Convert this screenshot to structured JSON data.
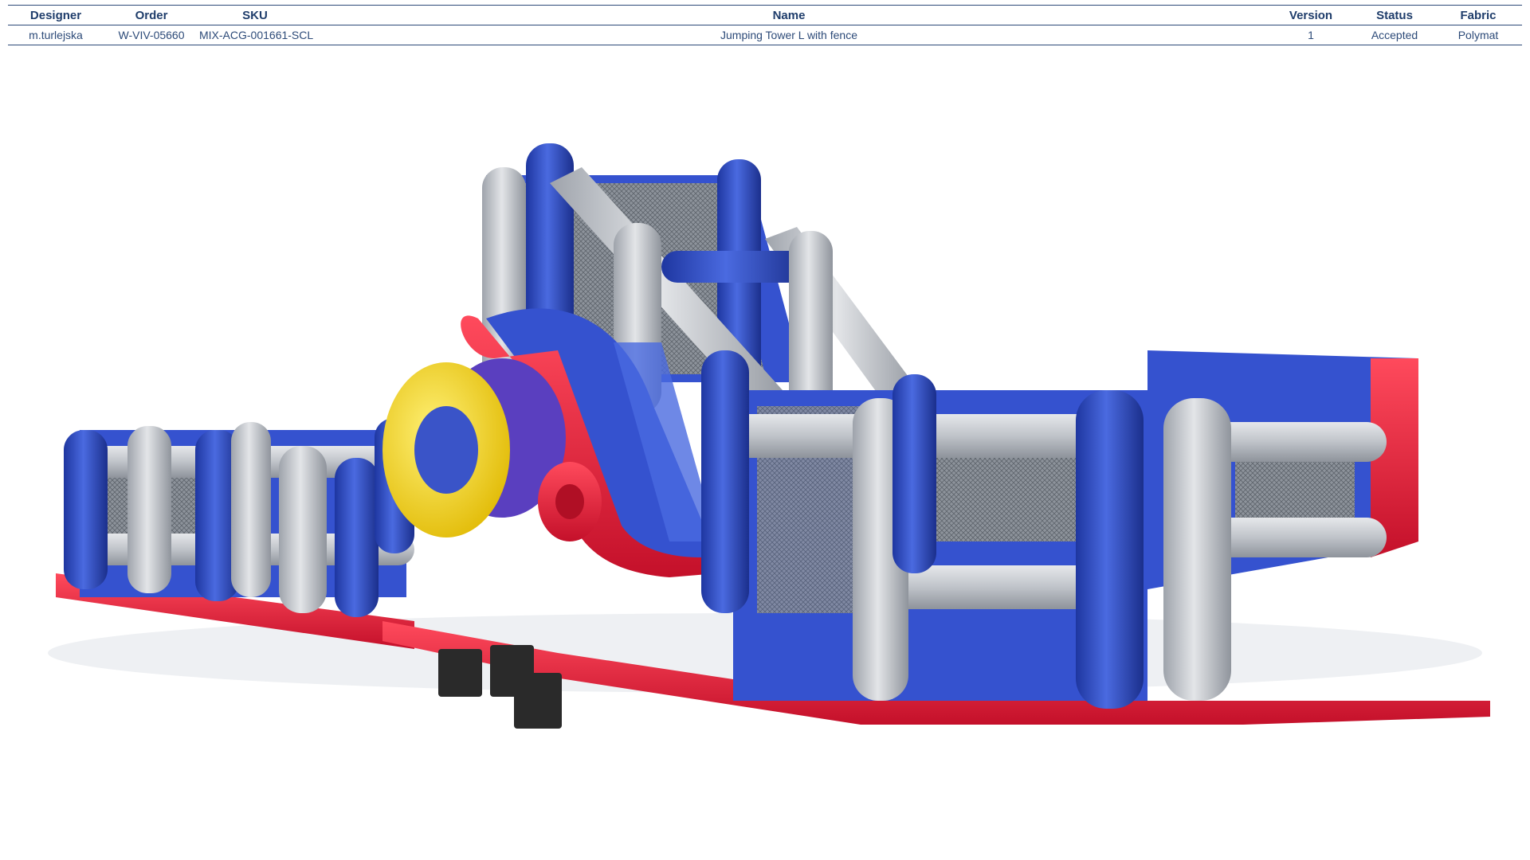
{
  "spec": {
    "headers": {
      "designer": "Designer",
      "order": "Order",
      "sku": "SKU",
      "name": "Name",
      "version": "Version",
      "status": "Status",
      "fabric": "Fabric"
    },
    "row": {
      "designer": "m.turlejska",
      "order": "W-VIV-05660",
      "sku": "MIX-ACG-001661-SCL",
      "name": "Jumping Tower L with fence",
      "version": "1",
      "status": "Accepted",
      "fabric": "Polymat"
    }
  },
  "colors": {
    "blue": "#2f4fc9",
    "blue_dark": "#1e36a0",
    "gray": "#b9bdc4",
    "gray_light": "#d6d9de",
    "red": "#e8213a",
    "yellow": "#f6d21a",
    "net": "#9aa0a8",
    "blower": "#2a2a2a",
    "header_text": "#1f3d6b"
  },
  "image": {
    "subject": "inflatable-obstacle-course-render"
  }
}
